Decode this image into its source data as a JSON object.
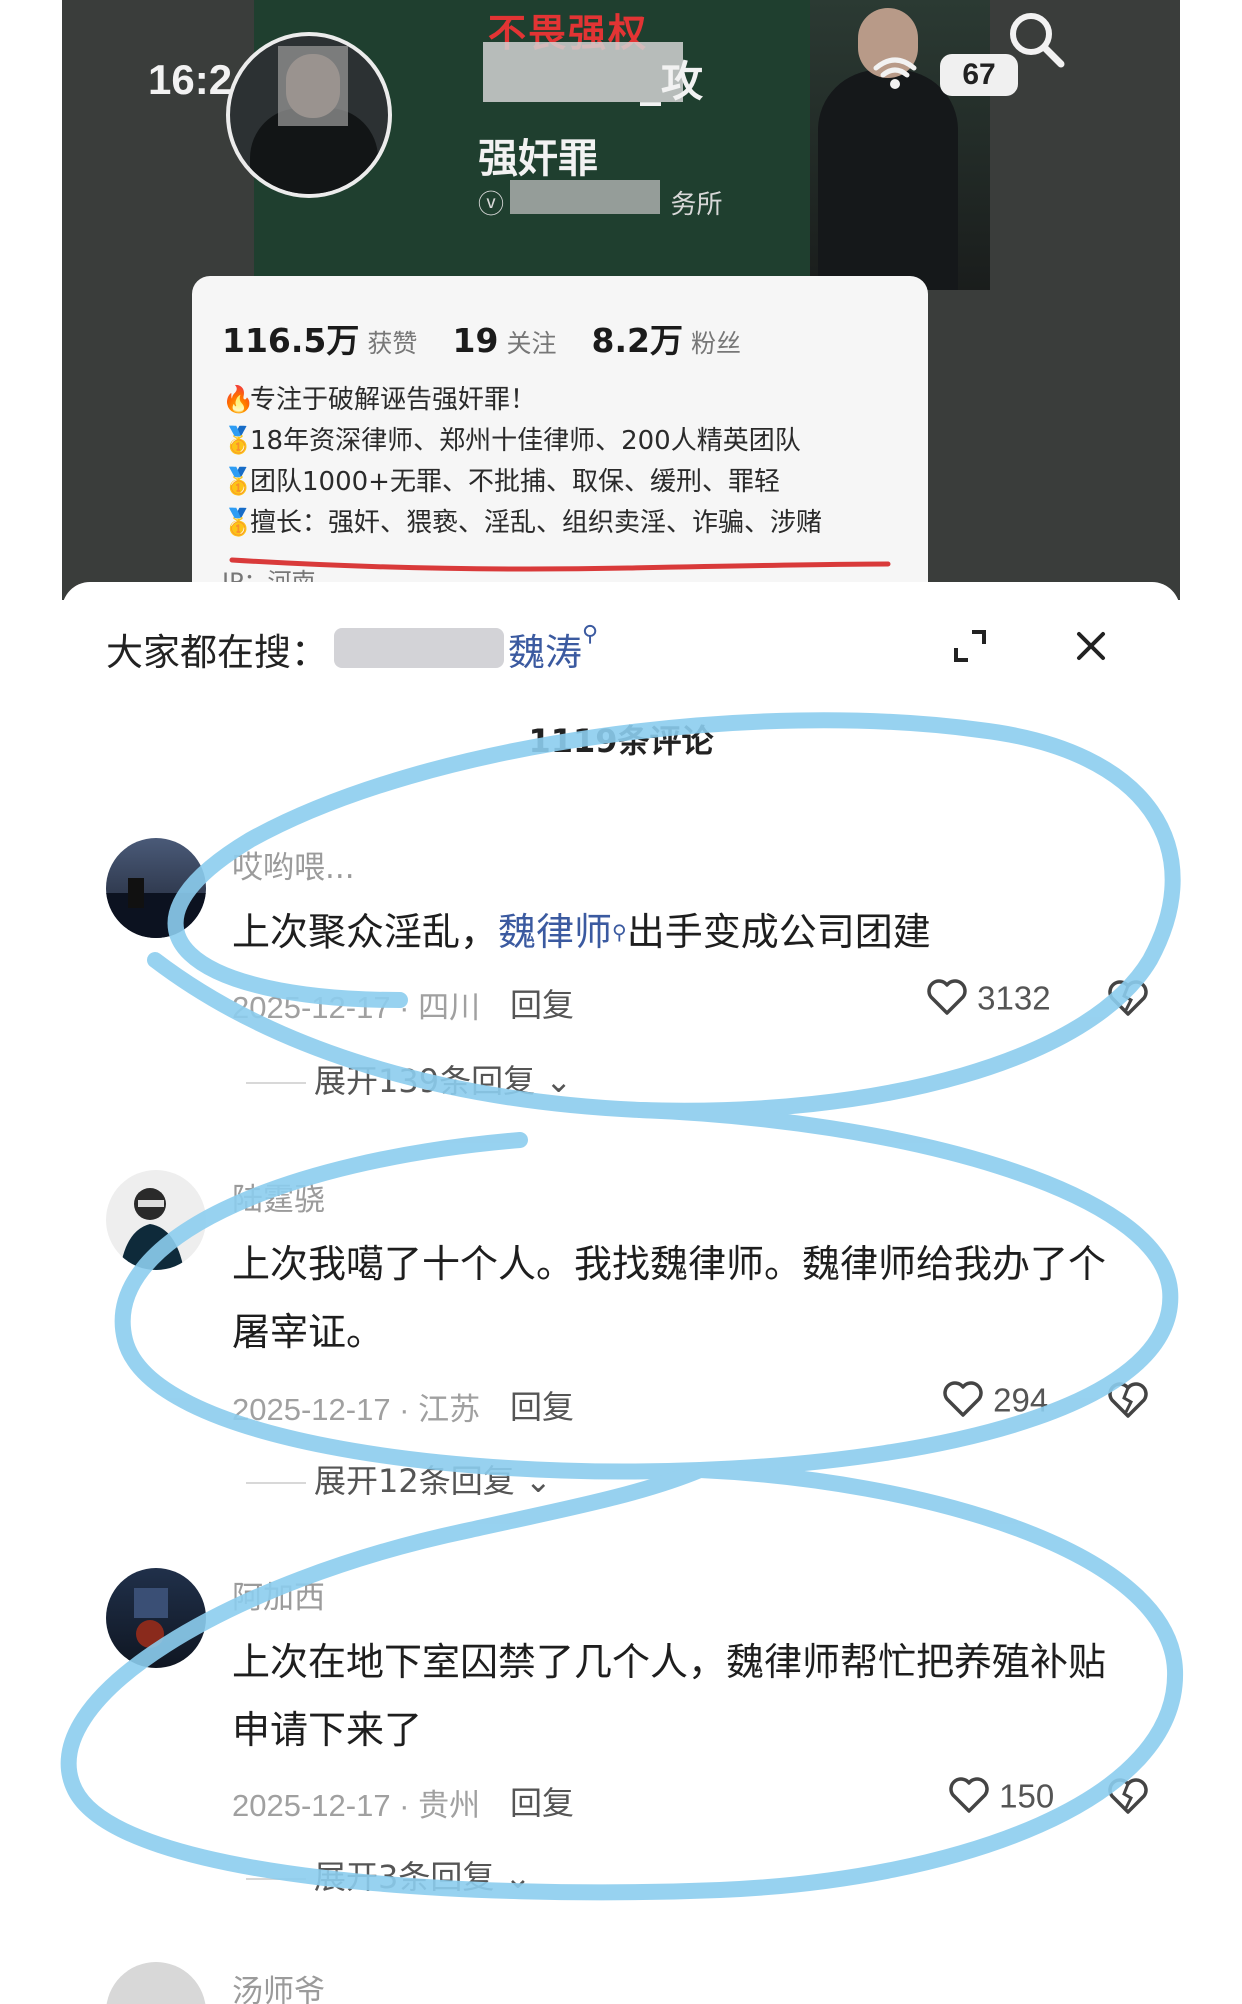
{
  "status_bar": {
    "time": "16:2",
    "battery": "67"
  },
  "profile": {
    "cover_title": "不畏强权",
    "name_fragment": "_攻",
    "name_line2": "强奸罪",
    "verify_suffix": "务所",
    "stats": [
      {
        "num": "116.5万",
        "label": "获赞"
      },
      {
        "num": "19",
        "label": "关注"
      },
      {
        "num": "8.2万",
        "label": "粉丝"
      }
    ],
    "bio": [
      {
        "icon": "🔥",
        "text": "专注于破解诬告强奸罪！"
      },
      {
        "icon": "🥇",
        "text": "18年资深律师、郑州十佳律师、200人精英团队"
      },
      {
        "icon": "🥇",
        "text": "团队1000+无罪、不批捕、取保、缓刑、罪轻"
      },
      {
        "icon": "🥇",
        "text": "擅长：强奸、猥亵、淫乱、组织卖淫、诈骗、涉赌"
      }
    ],
    "ip": "IP：河南"
  },
  "sheet": {
    "search_prefix": "大家都在搜：",
    "search_suffix": "魏涛",
    "comment_count": "1119条评论",
    "comments": [
      {
        "user": "哎哟喂...",
        "text_before": "上次聚众淫乱，",
        "mention": "魏律师",
        "text_after": "出手变成公司团建",
        "date_loc": "2025-12-17 · 四川",
        "reply": "回复",
        "likes": "3132",
        "expand": "展开139条回复"
      },
      {
        "user": "陆霆骁",
        "text_before": "上次我噶了十个人。我找魏律师。魏律师给我办了个屠宰证。",
        "mention": "",
        "text_after": "",
        "date_loc": "2025-12-17 · 江苏",
        "reply": "回复",
        "likes": "294",
        "expand": "展开12条回复"
      },
      {
        "user": "阿加西",
        "text_before": "上次在地下室囚禁了几个人，魏律师帮忙把养殖补贴申请下来了",
        "mention": "",
        "text_after": "",
        "date_loc": "2025-12-17 · 贵州",
        "reply": "回复",
        "likes": "150",
        "expand": "展开3条回复"
      },
      {
        "user": "汤师爷"
      }
    ]
  },
  "colors": {
    "scribble": "#8ccdee",
    "mention": "#3b5aa0",
    "underline": "#d93a3a"
  }
}
